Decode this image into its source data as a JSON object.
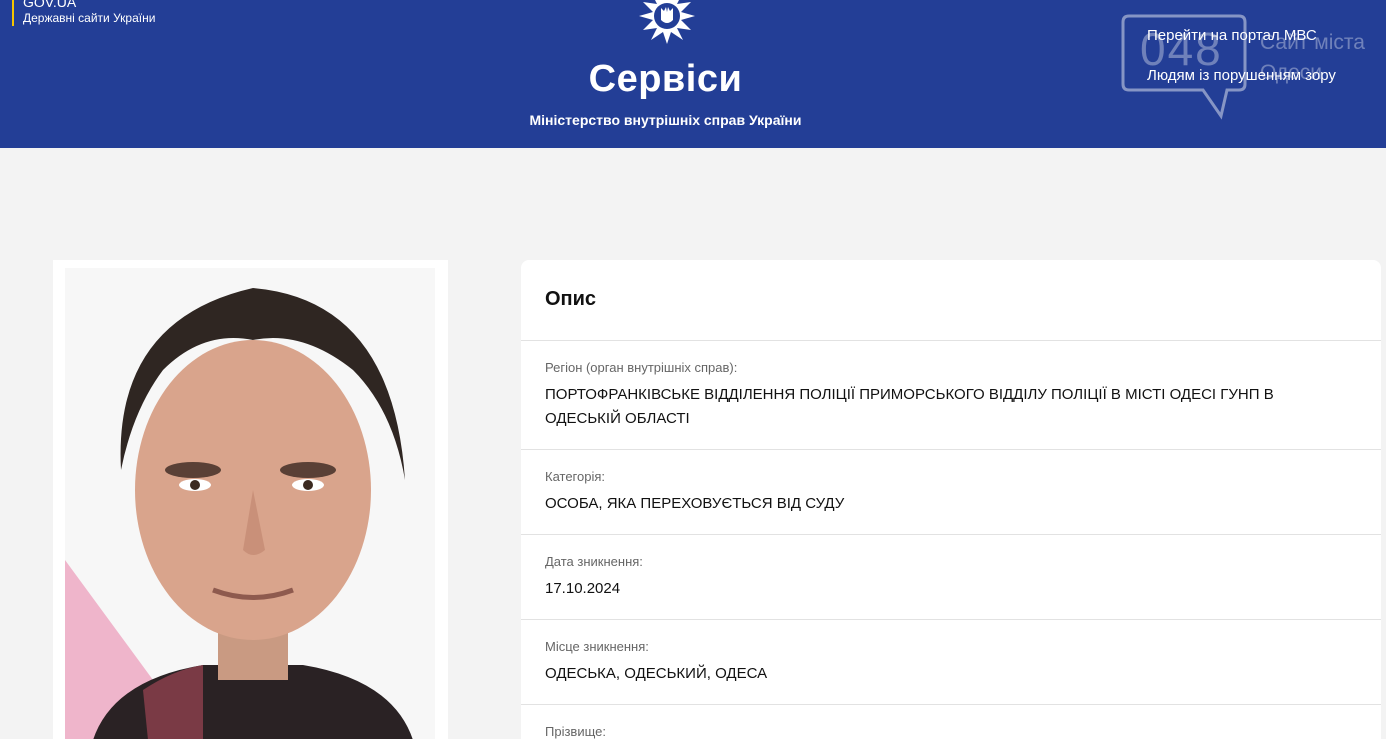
{
  "gov": {
    "title": "GOV.UA",
    "subtitle": "Державні сайти України"
  },
  "header": {
    "title": "Сервіси",
    "subtitle": "Міністерство внутрішніх справ України",
    "links": {
      "portal": "Перейти на портал МВС",
      "vision": "Людям із порушенням зору"
    },
    "color": "#233e96"
  },
  "watermark": {
    "number": "048",
    "text": "Сайт міста Одеси"
  },
  "description": {
    "title": "Опис",
    "fields": [
      {
        "label": "Регіон (орган внутрішніх справ):",
        "value": "ПОРТОФРАНКІВСЬКЕ ВІДДІЛЕННЯ ПОЛІЦІЇ ПРИМОРСЬКОГО ВІДДІЛУ ПОЛІЦІЇ В МІСТІ ОДЕСІ ГУНП В ОДЕСЬКІЙ ОБЛАСТІ"
      },
      {
        "label": "Категорія:",
        "value": "ОСОБА, ЯКА ПЕРЕХОВУЄТЬСЯ ВІД СУДУ"
      },
      {
        "label": "Дата зникнення:",
        "value": "17.10.2024"
      },
      {
        "label": "Місце зникнення:",
        "value": "ОДЕСЬКА, ОДЕСЬКИЙ, ОДЕСА"
      },
      {
        "label": "Прізвище:",
        "value": ""
      }
    ]
  }
}
